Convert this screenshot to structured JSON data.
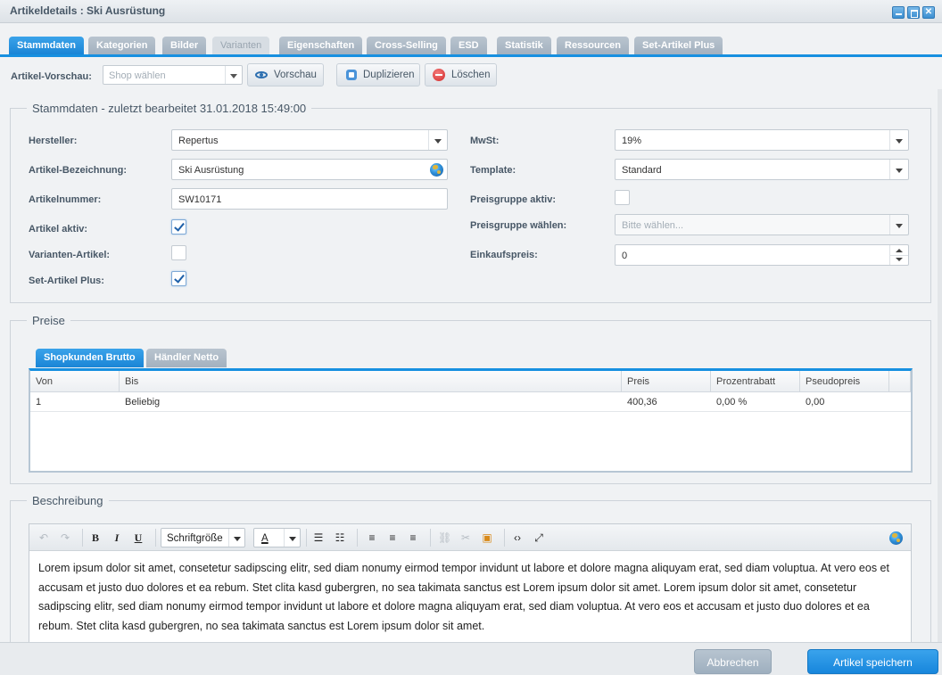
{
  "window": {
    "title": "Artikeldetails : Ski Ausrüstung"
  },
  "tabs": [
    {
      "label": "Stammdaten",
      "state": "active"
    },
    {
      "label": "Kategorien",
      "state": "normal"
    },
    {
      "label": "Bilder",
      "state": "normal"
    },
    {
      "label": "Varianten",
      "state": "disabled"
    },
    {
      "label": "Eigenschaften",
      "state": "normal"
    },
    {
      "label": "Cross-Selling",
      "state": "normal"
    },
    {
      "label": "ESD",
      "state": "normal"
    },
    {
      "label": "Statistik",
      "state": "normal"
    },
    {
      "label": "Ressourcen",
      "state": "normal"
    },
    {
      "label": "Set-Artikel Plus",
      "state": "normal"
    }
  ],
  "toolbar": {
    "preview_label": "Artikel-Vorschau:",
    "shop_placeholder": "Shop wählen",
    "preview_button": "Vorschau",
    "duplicate_button": "Duplizieren",
    "delete_button": "Löschen"
  },
  "stammdaten": {
    "legend": "Stammdaten - zuletzt bearbeitet 31.01.2018 15:49:00",
    "hersteller_label": "Hersteller:",
    "hersteller_value": "Repertus",
    "bezeichnung_label": "Artikel-Bezeichnung:",
    "bezeichnung_value": "Ski Ausrüstung",
    "artikelnummer_label": "Artikelnummer:",
    "artikelnummer_value": "SW10171",
    "aktiv_label": "Artikel aktiv:",
    "aktiv_checked": true,
    "varianten_label": "Varianten-Artikel:",
    "varianten_checked": false,
    "setartikel_label": "Set-Artikel Plus:",
    "setartikel_checked": true,
    "mwst_label": "MwSt:",
    "mwst_value": "19%",
    "template_label": "Template:",
    "template_value": "Standard",
    "preisgruppe_aktiv_label": "Preisgruppe aktiv:",
    "preisgruppe_aktiv_checked": false,
    "preisgruppe_waehlen_label": "Preisgruppe wählen:",
    "preisgruppe_placeholder": "Bitte wählen...",
    "einkaufspreis_label": "Einkaufspreis:",
    "einkaufspreis_value": "0"
  },
  "preise": {
    "legend": "Preise",
    "tabs": [
      "Shopkunden Brutto",
      "Händler Netto"
    ],
    "columns": [
      "Von",
      "Bis",
      "Preis",
      "Prozentrabatt",
      "Pseudopreis"
    ],
    "rows": [
      [
        "1",
        "Beliebig",
        "400,36",
        "0,00 %",
        "0,00"
      ]
    ]
  },
  "beschreibung": {
    "legend": "Beschreibung",
    "font_size_combo": "Schriftgröße",
    "font_color_letter": "A",
    "text": "Lorem ipsum dolor sit amet, consetetur sadipscing elitr, sed diam nonumy eirmod tempor invidunt ut labore et dolore magna aliquyam erat, sed diam voluptua. At vero eos et accusam et justo duo dolores et ea rebum. Stet clita kasd gubergren, no sea takimata sanctus est Lorem ipsum dolor sit amet. Lorem ipsum dolor sit amet, consetetur sadipscing elitr, sed diam nonumy eirmod tempor invidunt ut labore et dolore magna aliquyam erat, sed diam voluptua. At vero eos et accusam et justo duo dolores et ea rebum. Stet clita kasd gubergren, no sea takimata sanctus est Lorem ipsum dolor sit amet."
  },
  "footer": {
    "cancel_button": "Abbrechen",
    "save_button": "Artikel speichern"
  },
  "colors": {
    "accent": "#1790e0",
    "tab_inactive": "#a3b1bf",
    "label": "#475766"
  }
}
